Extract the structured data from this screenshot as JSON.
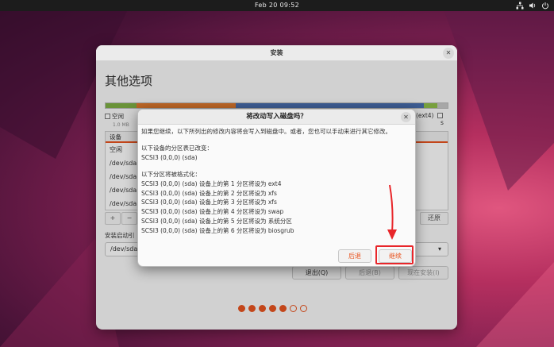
{
  "topbar": {
    "clock": "Feb 20  09:52"
  },
  "window": {
    "title": "安装",
    "heading": "其他选项",
    "legend": [
      {
        "label": "空闲",
        "size": "1.0 MB"
      },
      {
        "label": "(ext4)",
        "size": ""
      },
      {
        "label": "s",
        "size": ""
      }
    ],
    "table": {
      "header": "设备",
      "rows": [
        "空闲",
        "/dev/sda",
        "/dev/sda",
        "/dev/sda",
        "/dev/sda"
      ]
    },
    "controls": {
      "add": "+",
      "remove": "−",
      "revert": "还原"
    },
    "boot_loader_label": "安装启动引",
    "boot_loader_value": "/dev/sda",
    "buttons": {
      "quit": "退出(Q)",
      "back": "后退(B)",
      "install": "现在安装(I)"
    },
    "progress": {
      "total": 7,
      "filled": 5
    }
  },
  "dialog": {
    "title": "将改动写入磁盘吗？",
    "intro": "如果您继续，以下所列出的修改内容将会写入到磁盘中。或者，您也可以手动来进行其它修改。",
    "table_changed_heading": "以下设备的分区表已改变：",
    "changed_devices": [
      "SCSI3 (0,0,0) (sda)"
    ],
    "format_heading": "以下分区将被格式化：",
    "format_items": [
      "SCSI3 (0,0,0) (sda) 设备上的第 1 分区将设为 ext4",
      "SCSI3 (0,0,0) (sda) 设备上的第 2 分区将设为 xfs",
      "SCSI3 (0,0,0) (sda) 设备上的第 3 分区将设为 xfs",
      "SCSI3 (0,0,0) (sda) 设备上的第 4 分区将设为 swap",
      "SCSI3 (0,0,0) (sda) 设备上的第 5 分区将设为 系统分区",
      "SCSI3 (0,0,0) (sda) 设备上的第 6 分区将设为 biosgrub"
    ],
    "back_label": "后退",
    "continue_label": "继续"
  },
  "colors": {
    "accent": "#e95420",
    "highlight_red": "#e8262a"
  }
}
